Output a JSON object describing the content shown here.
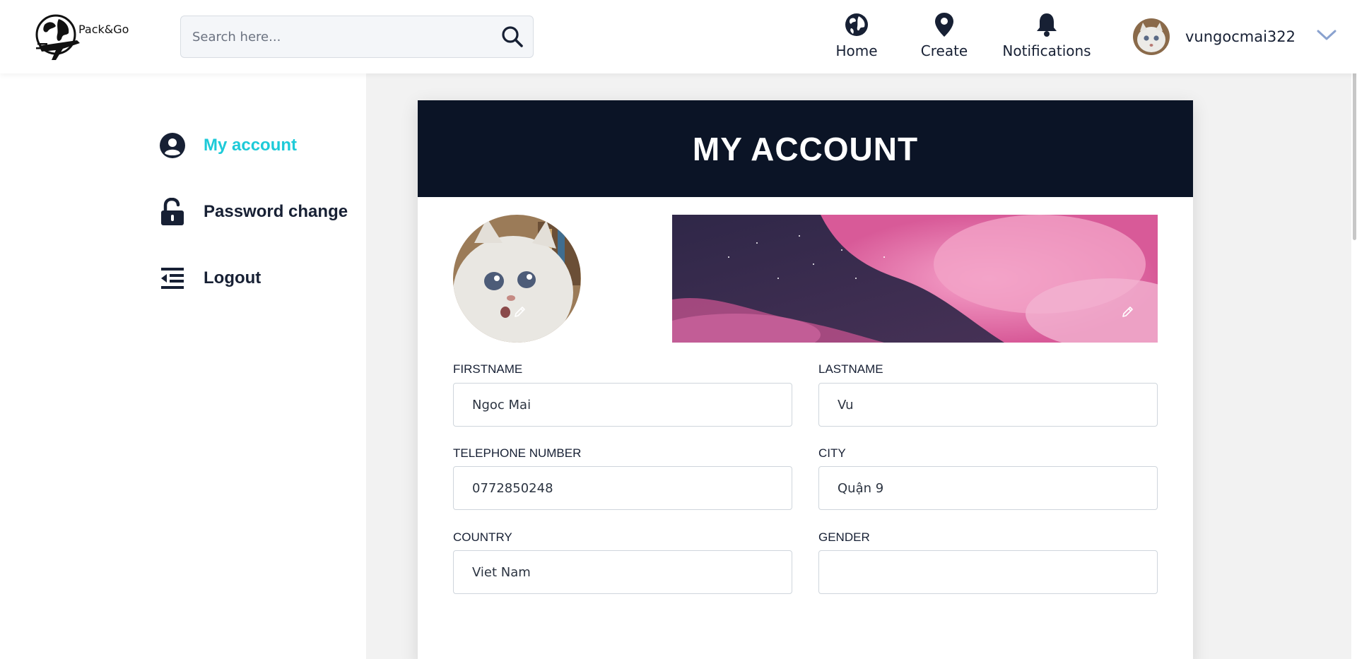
{
  "header": {
    "logo_text": "Pack&Go",
    "search": {
      "placeholder": "Search here...",
      "value": ""
    },
    "nav": {
      "home_label": "Home",
      "create_label": "Create",
      "notifications_label": "Notifications"
    },
    "user": {
      "username": "vungocmai322"
    }
  },
  "sidebar": {
    "items": [
      {
        "label": "My account",
        "icon": "user-circle-icon",
        "active": true
      },
      {
        "label": "Password change",
        "icon": "unlock-icon",
        "active": false
      },
      {
        "label": "Logout",
        "icon": "logout-indent-icon",
        "active": false
      }
    ]
  },
  "account": {
    "title": "MY ACCOUNT",
    "fields": {
      "firstname": {
        "label": "FIRSTNAME",
        "value": "Ngoc Mai"
      },
      "lastname": {
        "label": "LASTNAME",
        "value": "Vu"
      },
      "telephone": {
        "label": "TELEPHONE NUMBER",
        "value": "0772850248"
      },
      "city": {
        "label": "CITY",
        "value": "Quận 9"
      },
      "country": {
        "label": "COUNTRY",
        "value": "Viet Nam"
      },
      "gender": {
        "label": "GENDER",
        "value": ""
      }
    }
  },
  "colors": {
    "accent": "#1ecad8",
    "dark": "#172034",
    "card_header": "#0b1426"
  }
}
